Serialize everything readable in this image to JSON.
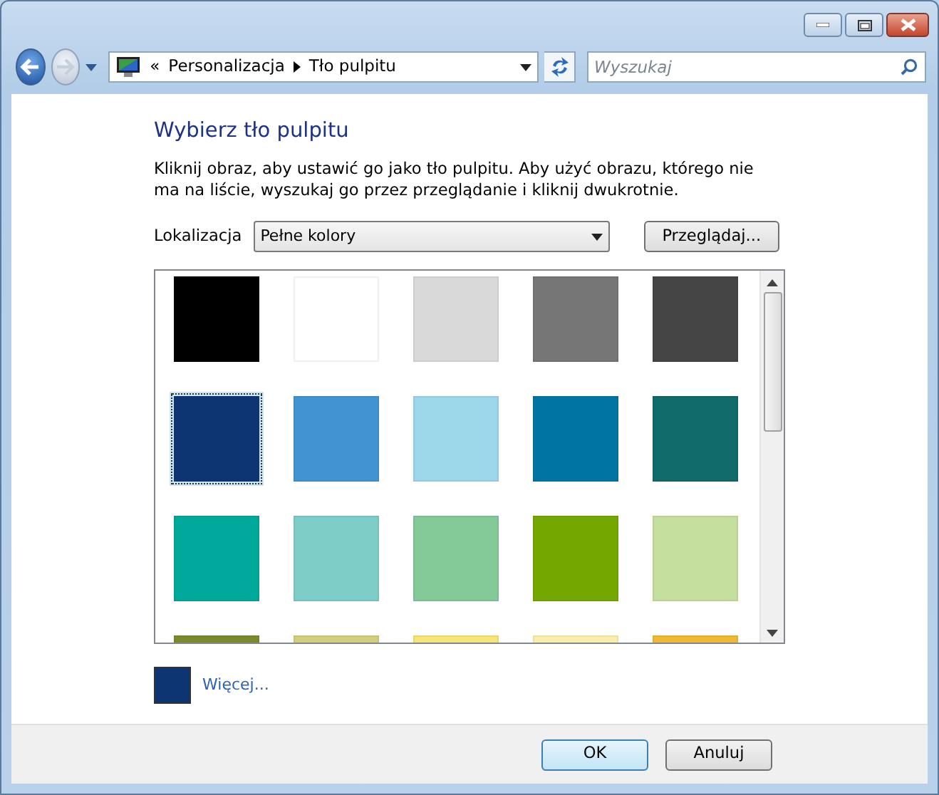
{
  "navigation": {
    "breadcrumb": [
      "Personalizacja",
      "Tło pulpitu"
    ],
    "overflow": "«",
    "search": {
      "placeholder": "Wyszukaj"
    }
  },
  "heading": "Wybierz tło pulpitu",
  "description": "Kliknij obraz, aby ustawić go jako tło pulpitu. Aby użyć obrazu, którego nie ma na liście, wyszukaj go przez przeglądanie i kliknij dwukrotnie.",
  "location": {
    "label": "Lokalizacja",
    "value": "Pełne kolory",
    "browse_button": "Przeglądaj..."
  },
  "swatches": [
    {
      "color": "#000000",
      "selected": false
    },
    {
      "color": "#ffffff",
      "selected": false
    },
    {
      "color": "#d9d9d9",
      "selected": false
    },
    {
      "color": "#767676",
      "selected": false
    },
    {
      "color": "#454545",
      "selected": false
    },
    {
      "color": "#0d3572",
      "selected": true
    },
    {
      "color": "#4293d1",
      "selected": false
    },
    {
      "color": "#9cd7ea",
      "selected": false
    },
    {
      "color": "#0075a3",
      "selected": false
    },
    {
      "color": "#106b6a",
      "selected": false
    },
    {
      "color": "#00a99c",
      "selected": false
    },
    {
      "color": "#7ecdc7",
      "selected": false
    },
    {
      "color": "#84c998",
      "selected": false
    },
    {
      "color": "#74a700",
      "selected": false
    },
    {
      "color": "#c5df9e",
      "selected": false
    },
    {
      "color": "#7d8a2b",
      "selected": false
    },
    {
      "color": "#d3ce7c",
      "selected": false
    },
    {
      "color": "#f6e675",
      "selected": false
    },
    {
      "color": "#fbeeaa",
      "selected": false
    },
    {
      "color": "#f0b933",
      "selected": false
    }
  ],
  "more": {
    "color": "#0d3572",
    "label": "Więcej..."
  },
  "buttons": [
    {
      "label": "OK",
      "default": true
    },
    {
      "label": "Anuluj",
      "default": false
    }
  ]
}
